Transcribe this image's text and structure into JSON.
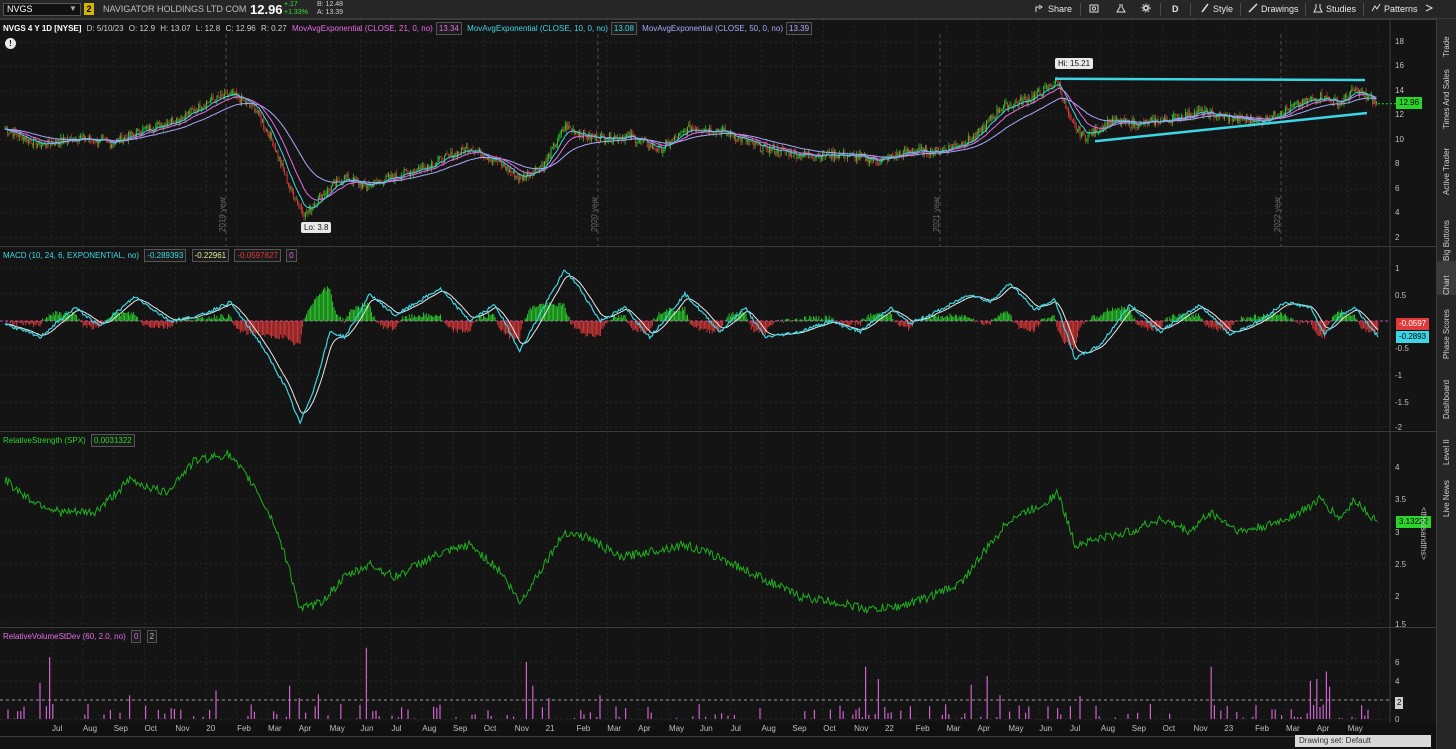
{
  "header": {
    "symbol": "NVGS",
    "link_badge": "2",
    "company": "NAVIGATOR HOLDINGS LTD COM",
    "last": "12.96",
    "change": "+.17",
    "change_pct": "+1.33%",
    "bid": "B: 12.48",
    "ask": "A: 13.39",
    "buttons": [
      "Share",
      "D",
      "Style",
      "Drawings",
      "Studies",
      "Patterns"
    ]
  },
  "side_tabs": [
    "Trade",
    "Times And Sales",
    "Active Trader",
    "Big Buttons",
    "Chart",
    "Phase Scores",
    "Dashboard",
    "Level II",
    "Live News"
  ],
  "price_pane": {
    "title": "NVGS 4 Y 1D [NYSE]",
    "date": "D: 5/10/23",
    "open": "O: 12.9",
    "high": "H: 13.07",
    "low": "L: 12.8",
    "close": "C: 12.96",
    "range": "R: 0.27",
    "studies": [
      {
        "label": "MovAvgExponential (CLOSE, 21, 0, no)",
        "value": "13.34",
        "color": "#e86be8"
      },
      {
        "label": "MovAvgExponential (CLOSE, 10, 0, no)",
        "value": "13.08",
        "color": "#3cd6e6"
      },
      {
        "label": "MovAvgExponential (CLOSE, 50, 0, no)",
        "value": "13.39",
        "color": "#a9a9ff"
      }
    ],
    "price_tag": "12.96",
    "y_ticks": [
      "18",
      "16",
      "14",
      "12",
      "10",
      "8",
      "6",
      "4",
      "2"
    ],
    "hi_label": "Hi: 15.21",
    "lo_label": "Lo: 3.8",
    "year_labels": [
      "2019 year",
      "2020 year",
      "2021 year",
      "2022 year"
    ]
  },
  "macd_pane": {
    "label": "MACD (10, 24, 6, EXPONENTIAL, no)",
    "v1": "-0.289393",
    "v2": "-0.22961",
    "v3": "-0.0597827",
    "v4": "0",
    "tag_hist": "-0.0597",
    "tag_value": "-0.2893",
    "y_ticks": [
      "1",
      "0.5",
      "0",
      "-0.5",
      "-1",
      "-1.5",
      "-2"
    ]
  },
  "rs_pane": {
    "label": "RelativeStrength (SPX)",
    "value": "0.0031322",
    "tag": "3.13222",
    "axis_unit": "<thousandths>",
    "y_ticks": [
      "4",
      "3.5",
      "3",
      "2.5",
      "2",
      "1.5"
    ]
  },
  "rvol_pane": {
    "label": "RelativeVolumeStDev (60, 2.0, no)",
    "v1": "0",
    "v2": "2",
    "tag": "2",
    "y_ticks": [
      "6",
      "4",
      "2",
      "0"
    ]
  },
  "x_axis": [
    "Jul",
    "Aug",
    "Sep",
    "Oct",
    "Nov",
    "20",
    "Feb",
    "Mar",
    "Apr",
    "May",
    "Jun",
    "Jul",
    "Aug",
    "Sep",
    "Oct",
    "Nov",
    "21",
    "Feb",
    "Mar",
    "Apr",
    "May",
    "Jun",
    "Jul",
    "Aug",
    "Sep",
    "Oct",
    "Nov",
    "22",
    "Feb",
    "Mar",
    "Apr",
    "May",
    "Jun",
    "Jul",
    "Aug",
    "Sep",
    "Oct",
    "Nov",
    "23",
    "Feb",
    "Mar",
    "Apr",
    "May"
  ],
  "footer": "Drawing set: Default",
  "colors": {
    "up": "#2bd42b",
    "down": "#e03a3a",
    "ema21": "#e86be8",
    "ema10": "#3cd6e6",
    "ema50": "#a9a9ff",
    "trendline": "#3cd6e6",
    "rs_line": "#1fae1f",
    "rvol_bar": "#d062d0"
  }
}
